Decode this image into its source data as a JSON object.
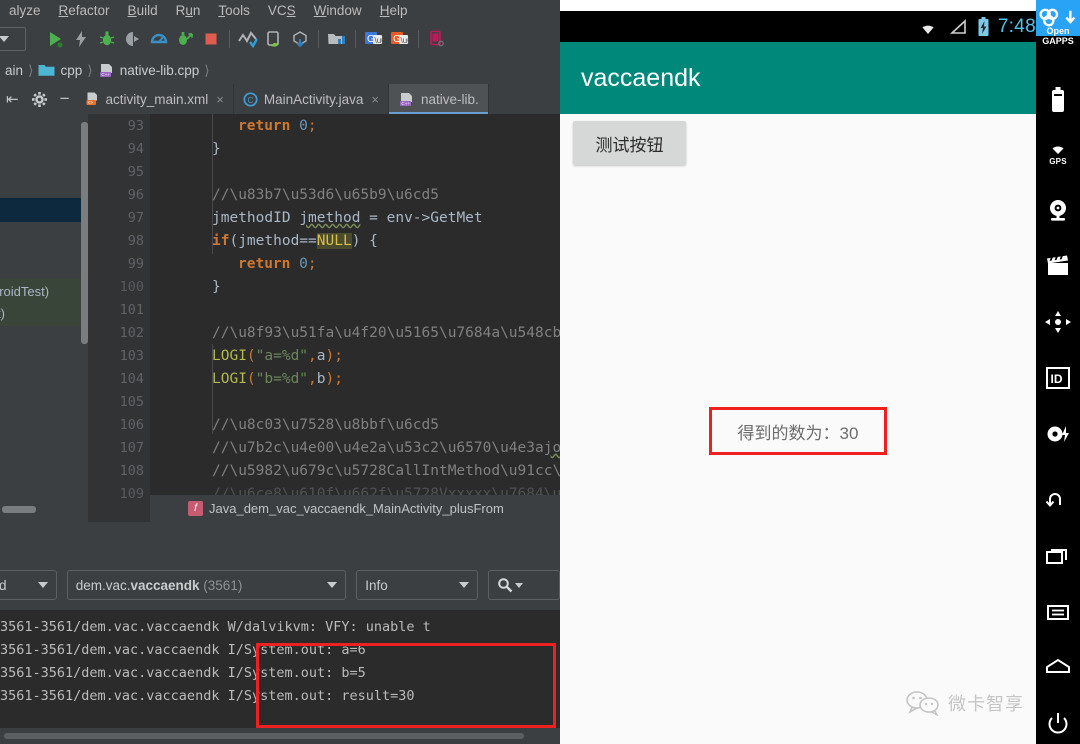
{
  "ide": {
    "menu": [
      "alyze",
      "Refactor",
      "Build",
      "Run",
      "Tools",
      "VCS",
      "Window",
      "Help"
    ],
    "toolbar_icons": [
      "combo-dropdown",
      "run-icon",
      "apply-changes-icon",
      "debug-icon",
      "attach-debugger-icon",
      "profiler-icon",
      "instant-run-icon",
      "stop-icon",
      "sync-gradle-icon",
      "avd-manager-icon",
      "sdk-manager-icon",
      "project-structure-icon",
      "google-translate-blue-icon",
      "google-translate-orange-icon",
      "device-manager-icon"
    ],
    "breadcrumbs": [
      "ain",
      "cpp",
      "native-lib.cpp"
    ],
    "tabs": [
      {
        "label": "activity_main.xml",
        "icon": "xml-file-icon",
        "active": false,
        "close": "×"
      },
      {
        "label": "MainActivity.java",
        "icon": "java-class-icon",
        "active": false,
        "close": "×"
      },
      {
        "label": "native-lib.",
        "icon": "cpp-file-icon",
        "active": true,
        "close": ""
      }
    ],
    "project_tree_fragments": [
      "droidTest)",
      "t)"
    ],
    "editor": {
      "first_line_number": 93,
      "lines": [
        {
          "n": 93,
          "text": "        return 0;"
        },
        {
          "n": 94,
          "text": "    }"
        },
        {
          "n": 95,
          "text": ""
        },
        {
          "n": 96,
          "text": "    //获取方法"
        },
        {
          "n": 97,
          "text": "    jmethodID jmethod = env->GetMet"
        },
        {
          "n": 98,
          "text": "    if(jmethod==NULL) {"
        },
        {
          "n": 99,
          "text": "        return 0;"
        },
        {
          "n": 100,
          "text": "    }"
        },
        {
          "n": 101,
          "text": ""
        },
        {
          "n": 102,
          "text": "    //输出传入的a和b参数"
        },
        {
          "n": 103,
          "text": "    LOGI(\"a=%d\",a);"
        },
        {
          "n": 104,
          "text": "    LOGI(\"b=%d\",b);"
        },
        {
          "n": 105,
          "text": ""
        },
        {
          "n": 106,
          "text": "    //调用访法"
        },
        {
          "n": 107,
          "text": "    //第一个参数为jobject的这是传入的"
        },
        {
          "n": 108,
          "text": "    //如果在CallIntMethod里面直接用传"
        },
        {
          "n": 109,
          "text": "    //注意是在Vxxxxx的类里面，所以"
        }
      ],
      "status_symbol": "Java_dem_vac_vaccaendk_MainActivity_plusFrom",
      "status_icon": "function-icon"
    },
    "logcat_toolbar": {
      "device_combo": "d",
      "process_combo": "dem.vac.vaccaendk (3561)",
      "process_prefix": "dem.vac.",
      "process_bold": "vaccaendk",
      "process_pid": "(3561)",
      "level_combo": "Info",
      "search_icon": "search-icon"
    },
    "logcat_lines": [
      "3561-3561/dem.vac.vaccaendk W/dalvikvm: VFY: unable t",
      "3561-3561/dem.vac.vaccaendk I/System.out: a=6",
      "3561-3561/dem.vac.vaccaendk I/System.out: b=5",
      "3561-3561/dem.vac.vaccaendk I/System.out: result=30"
    ]
  },
  "emulator": {
    "statusbar": {
      "wifi_icon": "wifi-icon",
      "signal_icon": "signal-icon",
      "battery_icon": "battery-charging-icon",
      "time": "7:48"
    },
    "app": {
      "title": "vaccaendk",
      "button_label": "测试按钮",
      "result_text": "得到的数为：30"
    },
    "watermark": {
      "icon": "wechat-icon",
      "text": "微卡智享"
    }
  },
  "rail": {
    "header_icon": "opengapps-logo-icon",
    "header_download_icon": "download-arrow-icon",
    "header_label_line1": "Open",
    "header_label_line2": "GAPPS",
    "buttons": [
      {
        "name": "battery-icon",
        "label": ""
      },
      {
        "name": "gps-icon",
        "label": "GPS"
      },
      {
        "name": "camera-icon",
        "label": ""
      },
      {
        "name": "clapperboard-icon",
        "label": ""
      },
      {
        "name": "dpad-icon",
        "label": ""
      },
      {
        "name": "id-icon",
        "label": ""
      },
      {
        "name": "record-icon",
        "label": ""
      },
      {
        "name": "back-icon",
        "label": ""
      },
      {
        "name": "recents-icon",
        "label": ""
      },
      {
        "name": "menu-icon",
        "label": ""
      },
      {
        "name": "home-icon",
        "label": ""
      },
      {
        "name": "power-icon",
        "label": ""
      }
    ]
  },
  "colors": {
    "ide_chrome": "#3c3f41",
    "editor_bg": "#2b2b2b",
    "accent_teal": "#00897b",
    "highlight_red": "#ef2020",
    "clock_blue": "#4fc3e8"
  }
}
